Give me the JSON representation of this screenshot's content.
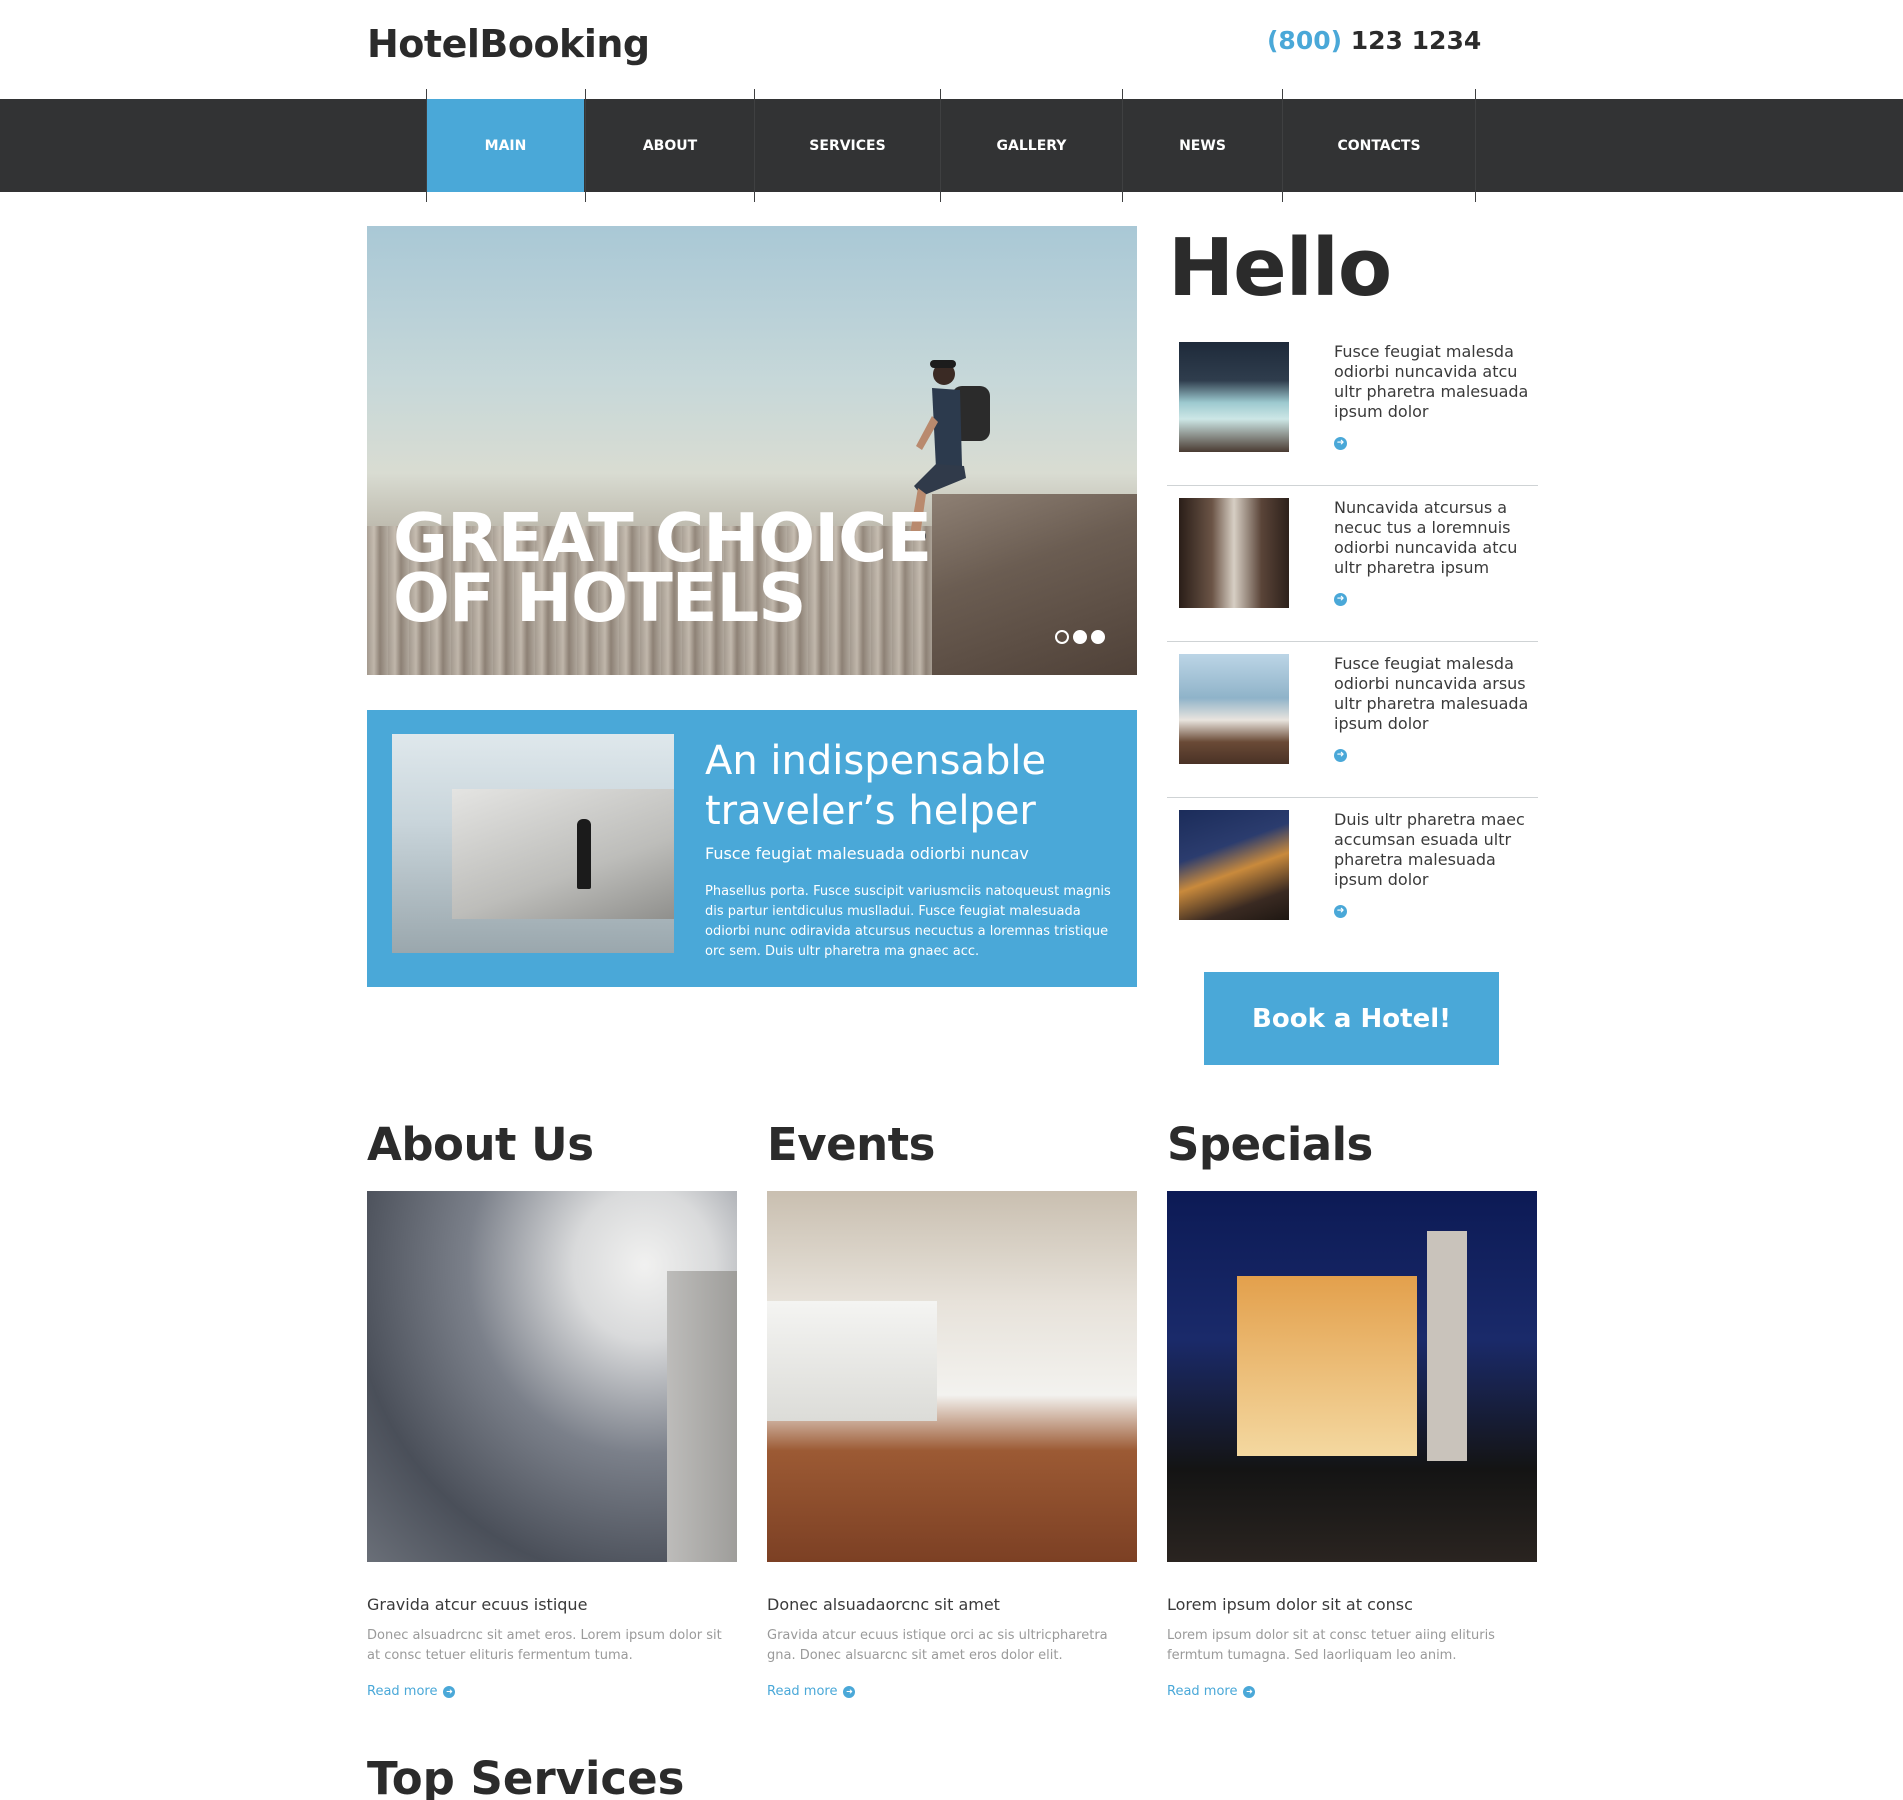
{
  "header": {
    "logo": "HotelBooking",
    "phone_code": "(800)",
    "phone_number": "123 1234"
  },
  "nav": {
    "items": [
      {
        "label": "MAIN",
        "active": true
      },
      {
        "label": "ABOUT",
        "active": false
      },
      {
        "label": "SERVICES",
        "active": false
      },
      {
        "label": "GALLERY",
        "active": false
      },
      {
        "label": "NEWS",
        "active": false
      },
      {
        "label": "CONTACTS",
        "active": false
      }
    ]
  },
  "slider": {
    "title": "GREAT CHOICE OF HOTELS",
    "dots": 3,
    "current_dot": 1
  },
  "helper": {
    "title": "An indispensable traveler’s helper",
    "subtitle": "Fusce feugiat malesuada odiorbi nuncav",
    "body": "Phasellus porta. Fusce suscipit variusmciis natoqueust magnis dis partur ientdiculus muslladui. Fusce feugiat malesuada odiorbi nunc odiravida atcursus necuctus a loremnas tristique orc sem. Duis ultr pharetra ma gnaec acc."
  },
  "sidebar": {
    "title": "Hello",
    "items": [
      {
        "text": "Fusce feugiat malesda odiorbi nuncavida atcu ultr pharetra malesuada ipsum dolor",
        "thumb_icon": "pool-photo"
      },
      {
        "text": "Nuncavida atcursus a necuc tus a loremnuis odiorbi nuncavida atcu ultr pharetra ipsum",
        "thumb_icon": "bathroom-photo"
      },
      {
        "text": "Fusce feugiat malesda odiorbi nuncavida arsus ultr pharetra malesuada ipsum dolor",
        "thumb_icon": "bathtub-photo"
      },
      {
        "text": "Duis ultr pharetra maec accumsan esuada ultr pharetra malesuada ipsum dolor",
        "thumb_icon": "house-photo"
      }
    ],
    "button": "Book a Hotel!"
  },
  "columns": [
    {
      "title": "About Us",
      "subtitle": "Gravida atcur ecuus istique",
      "text": "Donec alsuadrcnc sit amet eros. Lorem ipsum dolor sit at consc tetuer elituris fermentum tuma.",
      "more": "Read more"
    },
    {
      "title": "Events",
      "subtitle": "Donec alsuadaorcnc sit amet",
      "text": "Gravida atcur ecuus istique orci ac sis ultricpharetra gna. Donec alsuarcnc sit amet eros dolor elit.",
      "more": "Read more"
    },
    {
      "title": "Specials",
      "subtitle": "Lorem ipsum dolor sit at consc",
      "text": "Lorem ipsum dolor sit at consc tetuer aiing elituris fermtum tumagna. Sed laorliquam leo anim.",
      "more": "Read more"
    }
  ],
  "top_services": "Top Services",
  "colors": {
    "accent": "#4aa8d8",
    "nav_bg": "#323334",
    "text_dark": "#2b2b2b"
  }
}
